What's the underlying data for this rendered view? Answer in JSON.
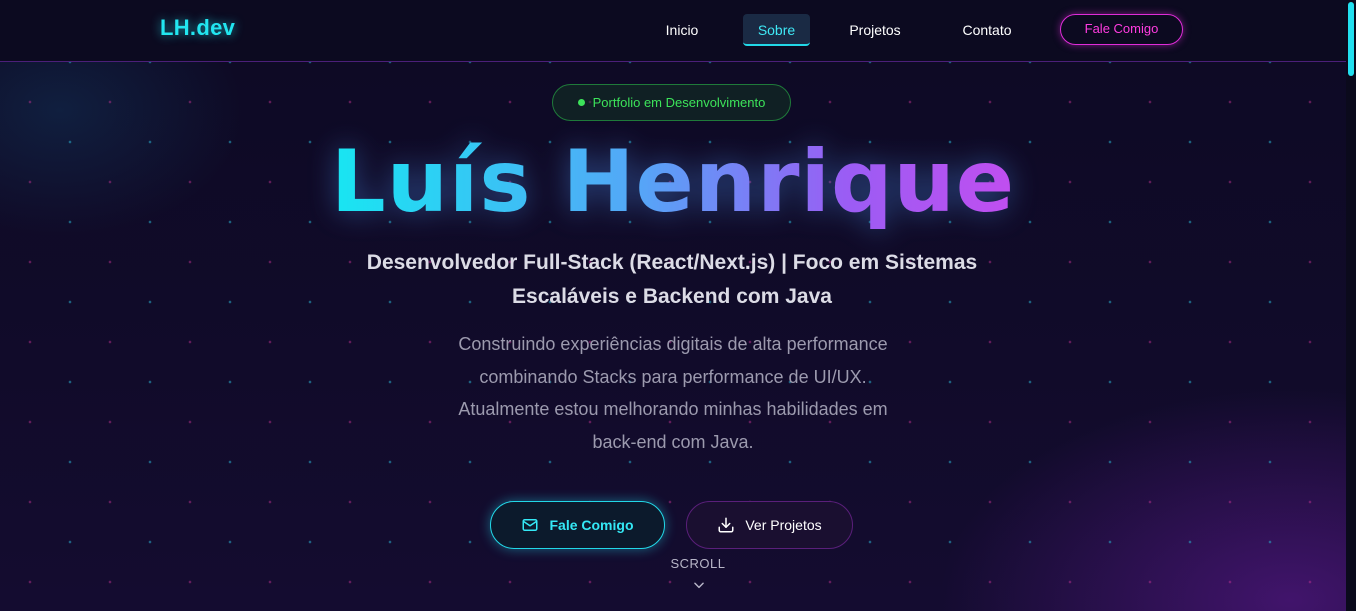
{
  "nav": {
    "logo": "LH.dev",
    "links": [
      {
        "label": "Inicio"
      },
      {
        "label": "Sobre",
        "active": true
      },
      {
        "label": "Projetos"
      },
      {
        "label": "Contato"
      }
    ],
    "cta_label": "Fale Comigo"
  },
  "hero": {
    "badge": "Portfolio em Desenvolvimento",
    "name": "Luís Henrique",
    "subtitle_line1": "Desenvolvedor Full-Stack (React/Next.js) | Foco em Sistemas",
    "subtitle_line2": "Escaláveis e Backend com Java",
    "description_lines": [
      "Construindo experiências digitais de alta performance",
      "combinando Stacks para performance de UI/UX.",
      "Atualmente estou melhorando minhas habilidades em",
      "back-end com Java."
    ],
    "primary_button": {
      "label": "Fale Comigo",
      "icon": "mail-icon"
    },
    "secondary_button": {
      "label": "Ver Projetos",
      "icon": "download-icon"
    },
    "scroll_label": "SCROLL"
  },
  "colors": {
    "accent_cyan": "#22e6f0",
    "accent_magenta": "#e02cd9",
    "accent_purple": "#c14ef0",
    "badge_green": "#3ce35a",
    "background": "#0d0a22"
  }
}
